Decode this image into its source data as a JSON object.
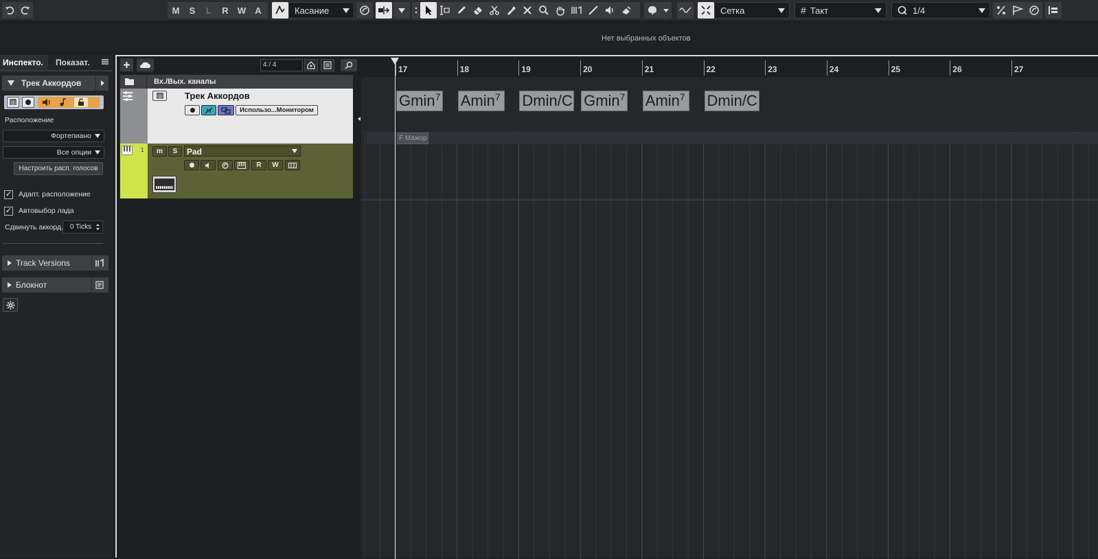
{
  "toolbar": {
    "mlr": [
      "M",
      "S",
      "L",
      "R",
      "W",
      "A"
    ],
    "automation_mode": "Касание",
    "snap_type": "Сетка",
    "grid_type": "Такт",
    "quantize": "1/4"
  },
  "infoline": {
    "message": "Нет выбранных объектов"
  },
  "inspector": {
    "tab_inspector": "Инспекто.",
    "tab_visibility": "Показат.",
    "track_header": "Трек Аккордов",
    "voicing_label": "Расположение",
    "voicing_value": "Фортепиано",
    "options_value": "Все опции",
    "voicing_config_button": "Настроить расп. голосов",
    "adaptive_voicing": "Адапт. расположение",
    "auto_scale": "Автовыбор лада",
    "shift_chord_label": "Сдвинуть аккорд.",
    "shift_chord_value": "0 Ticks",
    "track_versions": "Track Versions",
    "notepad": "Блокнот"
  },
  "tracklist": {
    "signature": "4 / 4",
    "io_channels": "Вх./Вых. каналы",
    "chord_track_name": "Трек Аккордов",
    "monitor_button": "Использо...Монитором",
    "instrument_track_number": "1",
    "instrument_track_name": "Pad",
    "btn_m": "m",
    "btn_s": "S",
    "btn_r": "R",
    "btn_w": "W"
  },
  "ruler": {
    "bars": [
      "17",
      "18",
      "19",
      "20",
      "21",
      "22",
      "23",
      "24",
      "25",
      "26",
      "27"
    ]
  },
  "chords": [
    {
      "root": "Gmin",
      "ext": "7"
    },
    {
      "root": "Amin",
      "ext": "7"
    },
    {
      "root": "Dmin/C",
      "ext": ""
    },
    {
      "root": "Gmin",
      "ext": "7"
    },
    {
      "root": "Amin",
      "ext": "7"
    },
    {
      "root": "Dmin/C",
      "ext": ""
    }
  ],
  "scale_event": "F Мажор"
}
